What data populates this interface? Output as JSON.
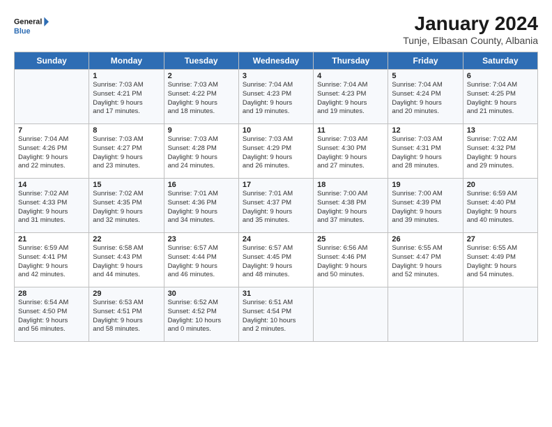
{
  "logo": {
    "line1": "General",
    "line2": "Blue"
  },
  "title": "January 2024",
  "subtitle": "Tunje, Elbasan County, Albania",
  "days_of_week": [
    "Sunday",
    "Monday",
    "Tuesday",
    "Wednesday",
    "Thursday",
    "Friday",
    "Saturday"
  ],
  "weeks": [
    [
      {
        "day": "",
        "info": ""
      },
      {
        "day": "1",
        "info": "Sunrise: 7:03 AM\nSunset: 4:21 PM\nDaylight: 9 hours\nand 17 minutes."
      },
      {
        "day": "2",
        "info": "Sunrise: 7:03 AM\nSunset: 4:22 PM\nDaylight: 9 hours\nand 18 minutes."
      },
      {
        "day": "3",
        "info": "Sunrise: 7:04 AM\nSunset: 4:23 PM\nDaylight: 9 hours\nand 19 minutes."
      },
      {
        "day": "4",
        "info": "Sunrise: 7:04 AM\nSunset: 4:23 PM\nDaylight: 9 hours\nand 19 minutes."
      },
      {
        "day": "5",
        "info": "Sunrise: 7:04 AM\nSunset: 4:24 PM\nDaylight: 9 hours\nand 20 minutes."
      },
      {
        "day": "6",
        "info": "Sunrise: 7:04 AM\nSunset: 4:25 PM\nDaylight: 9 hours\nand 21 minutes."
      }
    ],
    [
      {
        "day": "7",
        "info": "Sunrise: 7:04 AM\nSunset: 4:26 PM\nDaylight: 9 hours\nand 22 minutes."
      },
      {
        "day": "8",
        "info": "Sunrise: 7:03 AM\nSunset: 4:27 PM\nDaylight: 9 hours\nand 23 minutes."
      },
      {
        "day": "9",
        "info": "Sunrise: 7:03 AM\nSunset: 4:28 PM\nDaylight: 9 hours\nand 24 minutes."
      },
      {
        "day": "10",
        "info": "Sunrise: 7:03 AM\nSunset: 4:29 PM\nDaylight: 9 hours\nand 26 minutes."
      },
      {
        "day": "11",
        "info": "Sunrise: 7:03 AM\nSunset: 4:30 PM\nDaylight: 9 hours\nand 27 minutes."
      },
      {
        "day": "12",
        "info": "Sunrise: 7:03 AM\nSunset: 4:31 PM\nDaylight: 9 hours\nand 28 minutes."
      },
      {
        "day": "13",
        "info": "Sunrise: 7:02 AM\nSunset: 4:32 PM\nDaylight: 9 hours\nand 29 minutes."
      }
    ],
    [
      {
        "day": "14",
        "info": "Sunrise: 7:02 AM\nSunset: 4:33 PM\nDaylight: 9 hours\nand 31 minutes."
      },
      {
        "day": "15",
        "info": "Sunrise: 7:02 AM\nSunset: 4:35 PM\nDaylight: 9 hours\nand 32 minutes."
      },
      {
        "day": "16",
        "info": "Sunrise: 7:01 AM\nSunset: 4:36 PM\nDaylight: 9 hours\nand 34 minutes."
      },
      {
        "day": "17",
        "info": "Sunrise: 7:01 AM\nSunset: 4:37 PM\nDaylight: 9 hours\nand 35 minutes."
      },
      {
        "day": "18",
        "info": "Sunrise: 7:00 AM\nSunset: 4:38 PM\nDaylight: 9 hours\nand 37 minutes."
      },
      {
        "day": "19",
        "info": "Sunrise: 7:00 AM\nSunset: 4:39 PM\nDaylight: 9 hours\nand 39 minutes."
      },
      {
        "day": "20",
        "info": "Sunrise: 6:59 AM\nSunset: 4:40 PM\nDaylight: 9 hours\nand 40 minutes."
      }
    ],
    [
      {
        "day": "21",
        "info": "Sunrise: 6:59 AM\nSunset: 4:41 PM\nDaylight: 9 hours\nand 42 minutes."
      },
      {
        "day": "22",
        "info": "Sunrise: 6:58 AM\nSunset: 4:43 PM\nDaylight: 9 hours\nand 44 minutes."
      },
      {
        "day": "23",
        "info": "Sunrise: 6:57 AM\nSunset: 4:44 PM\nDaylight: 9 hours\nand 46 minutes."
      },
      {
        "day": "24",
        "info": "Sunrise: 6:57 AM\nSunset: 4:45 PM\nDaylight: 9 hours\nand 48 minutes."
      },
      {
        "day": "25",
        "info": "Sunrise: 6:56 AM\nSunset: 4:46 PM\nDaylight: 9 hours\nand 50 minutes."
      },
      {
        "day": "26",
        "info": "Sunrise: 6:55 AM\nSunset: 4:47 PM\nDaylight: 9 hours\nand 52 minutes."
      },
      {
        "day": "27",
        "info": "Sunrise: 6:55 AM\nSunset: 4:49 PM\nDaylight: 9 hours\nand 54 minutes."
      }
    ],
    [
      {
        "day": "28",
        "info": "Sunrise: 6:54 AM\nSunset: 4:50 PM\nDaylight: 9 hours\nand 56 minutes."
      },
      {
        "day": "29",
        "info": "Sunrise: 6:53 AM\nSunset: 4:51 PM\nDaylight: 9 hours\nand 58 minutes."
      },
      {
        "day": "30",
        "info": "Sunrise: 6:52 AM\nSunset: 4:52 PM\nDaylight: 10 hours\nand 0 minutes."
      },
      {
        "day": "31",
        "info": "Sunrise: 6:51 AM\nSunset: 4:54 PM\nDaylight: 10 hours\nand 2 minutes."
      },
      {
        "day": "",
        "info": ""
      },
      {
        "day": "",
        "info": ""
      },
      {
        "day": "",
        "info": ""
      }
    ]
  ]
}
